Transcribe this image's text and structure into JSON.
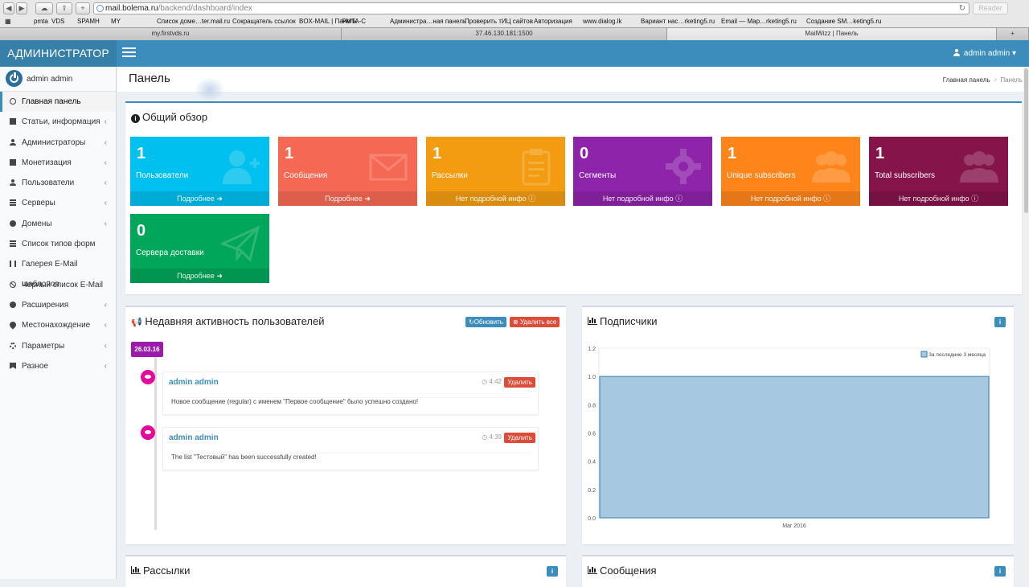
{
  "browser": {
    "url_host": "mail.bolema.ru",
    "url_path": "/backend/dashboard/index",
    "reader_label": "Reader",
    "bookmarks": [
      "pmta",
      "VDS",
      "SPAM",
      "H",
      "MY",
      "Список доме…ter.mail.ru",
      "Сокращатель ссылок",
      "BOX-MAIL | Панель",
      "PMTA-C",
      "Администра…ная панель",
      "Проверить тИЦ сайтов",
      "Авторизация",
      "www.dialog.lk",
      "Вариант нас…rketing5.ru",
      "Email — Map…rketing5.ru",
      "Создание SM…keting5.ru"
    ],
    "tabs": [
      "my.firstvds.ru",
      "37.46.130.181:1500",
      "MailWizz | Панель"
    ]
  },
  "header": {
    "logo": "АДМИНИСТРАТОР",
    "user": "admin admin"
  },
  "sidebar": {
    "user": "admin admin",
    "items": [
      {
        "label": "Главная панель",
        "icon": "dashboard-icon"
      },
      {
        "label": "Статьи, информация",
        "icon": "book-icon"
      },
      {
        "label": "Администраторы",
        "icon": "user-icon"
      },
      {
        "label": "Монетизация",
        "icon": "credit-card-icon"
      },
      {
        "label": "Пользователи",
        "icon": "users-icon"
      },
      {
        "label": "Серверы",
        "icon": "servers-icon"
      },
      {
        "label": "Домены",
        "icon": "globe-icon"
      },
      {
        "label": "Список типов форм",
        "icon": "list-icon"
      },
      {
        "label": "Галерея E-Mail шаблонов",
        "icon": "text-icon"
      },
      {
        "label": "Черный список E-Mail",
        "icon": "ban-icon"
      },
      {
        "label": "Расширения",
        "icon": "plus-circle-icon"
      },
      {
        "label": "Местонахождение",
        "icon": "location-icon"
      },
      {
        "label": "Параметры",
        "icon": "gear-icon"
      },
      {
        "label": "Разное",
        "icon": "bookmark-icon"
      }
    ]
  },
  "page": {
    "title": "Панель",
    "breadcrumb_home": "Главная панель",
    "breadcrumb_current": "Панель"
  },
  "overview": {
    "title": "Общий обзор",
    "tiles": [
      {
        "value": "1",
        "label": "Пользователи",
        "footer": "Подробнее",
        "color": "#00c0ef",
        "icon": "user-plus-icon"
      },
      {
        "value": "1",
        "label": "Сообщения",
        "footer": "Подробнее",
        "color": "#f56954",
        "icon": "envelope-icon"
      },
      {
        "value": "1",
        "label": "Рассылки",
        "footer": "Нет подробной инфо",
        "color": "#f39c12",
        "icon": "clipboard-icon"
      },
      {
        "value": "0",
        "label": "Сегменты",
        "footer": "Нет подробной инфо",
        "color": "#8e24aa",
        "icon": "cog-icon"
      },
      {
        "value": "1",
        "label": "Unique subscribers",
        "footer": "Нет подробной инфо",
        "color": "#ff851b",
        "icon": "users-icon"
      },
      {
        "value": "1",
        "label": "Total subscribers",
        "footer": "Нет подробной инфо",
        "color": "#85144b",
        "icon": "users-icon"
      },
      {
        "value": "0",
        "label": "Сервера доставки",
        "footer": "Подробнее",
        "color": "#00a65a",
        "icon": "paper-plane-icon"
      }
    ]
  },
  "activity": {
    "title": "Недавняя активность пользователей",
    "refresh_label": "Обновить",
    "delete_all_label": "Удалить все",
    "date": "26.03.16",
    "items": [
      {
        "author": "admin admin",
        "time": "4:42",
        "delete_label": "Удалить",
        "message": "Новое сообщение (regular) с именем \"Первое сообщение\" было успешно создано!"
      },
      {
        "author": "admin admin",
        "time": "4:39",
        "delete_label": "Удалить",
        "message": "The list \"Тестовый\" has been successfully created!"
      }
    ]
  },
  "subscribers": {
    "title": "Подписчики"
  },
  "chart_data": {
    "type": "area",
    "categories": [
      "Mar 2016"
    ],
    "series": [
      {
        "name": "За последние 3 месяца",
        "values": [
          1.0
        ]
      }
    ],
    "yticks": [
      "0.0",
      "0.2",
      "0.4",
      "0.6",
      "0.8",
      "1.0",
      "1.2"
    ],
    "ylim": [
      0,
      1.2
    ],
    "legend": "top-right",
    "color": "#a6c8e0",
    "grid": true
  },
  "bottom": {
    "campaigns_title": "Рассылки",
    "messages_title": "Сообщения"
  }
}
